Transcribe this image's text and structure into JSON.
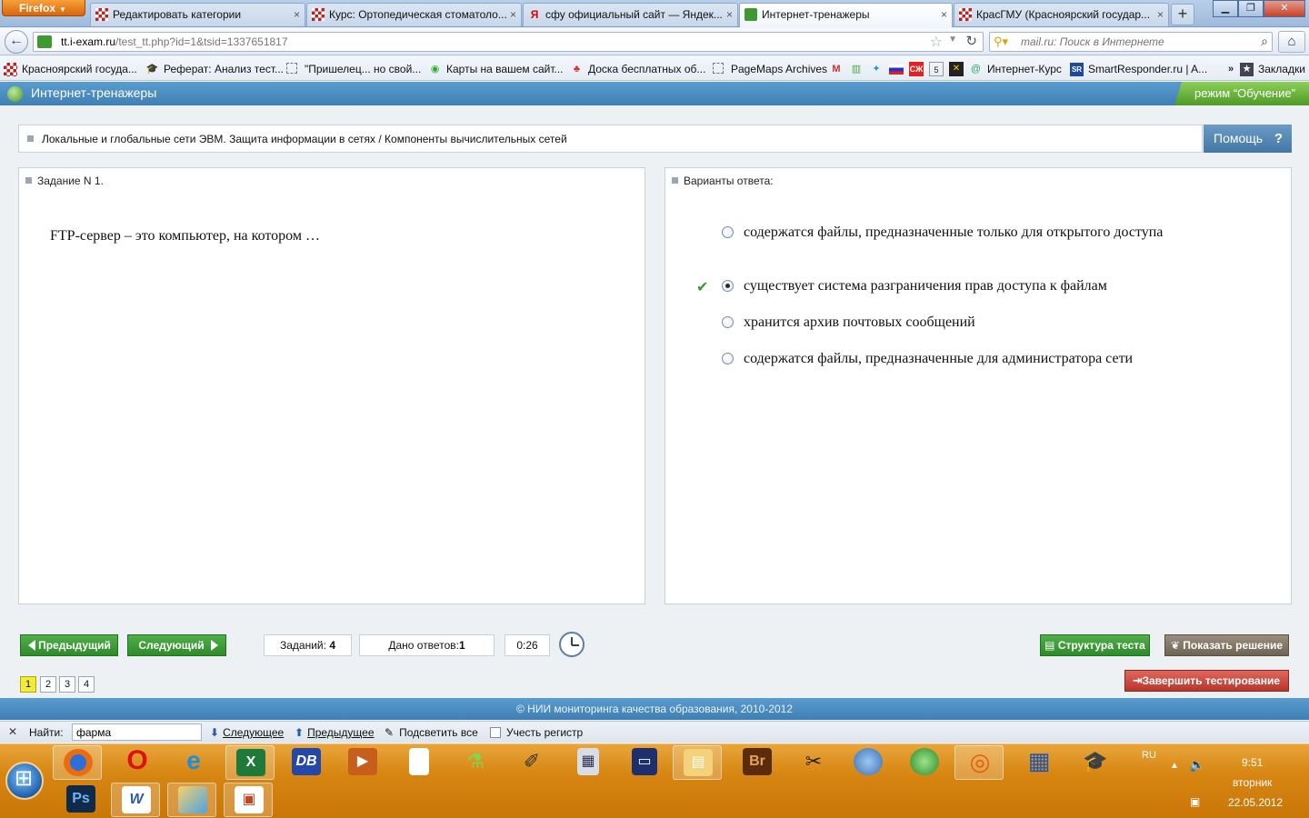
{
  "browser": {
    "menu_label": "Firefox",
    "tabs": [
      {
        "label": "Редактировать категории",
        "active": false
      },
      {
        "label": "Курс: Ортопедическая стоматоло...",
        "active": false
      },
      {
        "label": "сфу официальный сайт — Яндек...",
        "active": false
      },
      {
        "label": "Интернет-тренажеры",
        "active": true
      },
      {
        "label": "КрасГМУ (Красноярский государ...",
        "active": false
      }
    ],
    "url_host": "tt.i-exam.ru",
    "url_path": "/test_tt.php?id=1&tsid=1337651817",
    "search_placeholder": "mail.ru: Поиск в Интернете",
    "bookmarks": [
      "Красноярский госуда...",
      "Реферат: Анализ тест...",
      "\"Пришелец... но свой...",
      "Карты на вашем сайт...",
      "Доска бесплатных об...",
      "PageMaps Archives",
      "Интернет-Курс",
      "SmartResponder.ru | A...",
      "Закладки"
    ],
    "bookmarks_more": "»"
  },
  "app": {
    "title": "Интернет-тренажеры",
    "mode": "режим “Обучение”",
    "breadcrumb": "Локальные и глобальные сети ЭВМ. Защита информации в сетях / Компоненты вычислительных сетей",
    "help_label": "Помощь",
    "help_glyph": "?"
  },
  "task": {
    "header": "Задание N 1.",
    "question": "FTP-сервер – это компьютер, на котором …"
  },
  "answers": {
    "header": "Варианты ответа:",
    "options": [
      {
        "text": "содержатся файлы, предназначенные только для открытого доступа",
        "selected": false,
        "correct": false
      },
      {
        "text": "существует система разграничения прав доступа к файлам",
        "selected": true,
        "correct": true
      },
      {
        "text": "хранится архив почтовых сообщений",
        "selected": false,
        "correct": false
      },
      {
        "text": "содержатся файлы, предназначенные для администратора сети",
        "selected": false,
        "correct": false
      }
    ]
  },
  "controls": {
    "prev_label": "Предыдущий",
    "next_label": "Следующий",
    "tasks_label": "Заданий:",
    "tasks_count": "4",
    "answered_label": "Дано ответов:",
    "answered_count": "1",
    "timer": "0:26",
    "structure_label": "Структура теста",
    "solution_label": "Показать решение",
    "finish_label": "Завершить тестирование",
    "pages": [
      "1",
      "2",
      "3",
      "4"
    ],
    "current_page": "1"
  },
  "footer": "© НИИ мониторинга качества образования, 2010-2012",
  "findbar": {
    "label": "Найти:",
    "value": "фарма",
    "next": "Следующее",
    "prev": "Предыдущее",
    "highlight": "Подсветить все",
    "match_case": "Учесть регистр"
  },
  "tray": {
    "lang": "RU",
    "time": "9:51",
    "day": "вторник",
    "date": "22.05.2012"
  },
  "colors": {
    "header_blue": "#4a8bc1",
    "mode_green": "#6bb53d",
    "button_green": "#3d9b38",
    "finish_red": "#c9473a",
    "taskbar_orange": "#d78612"
  }
}
